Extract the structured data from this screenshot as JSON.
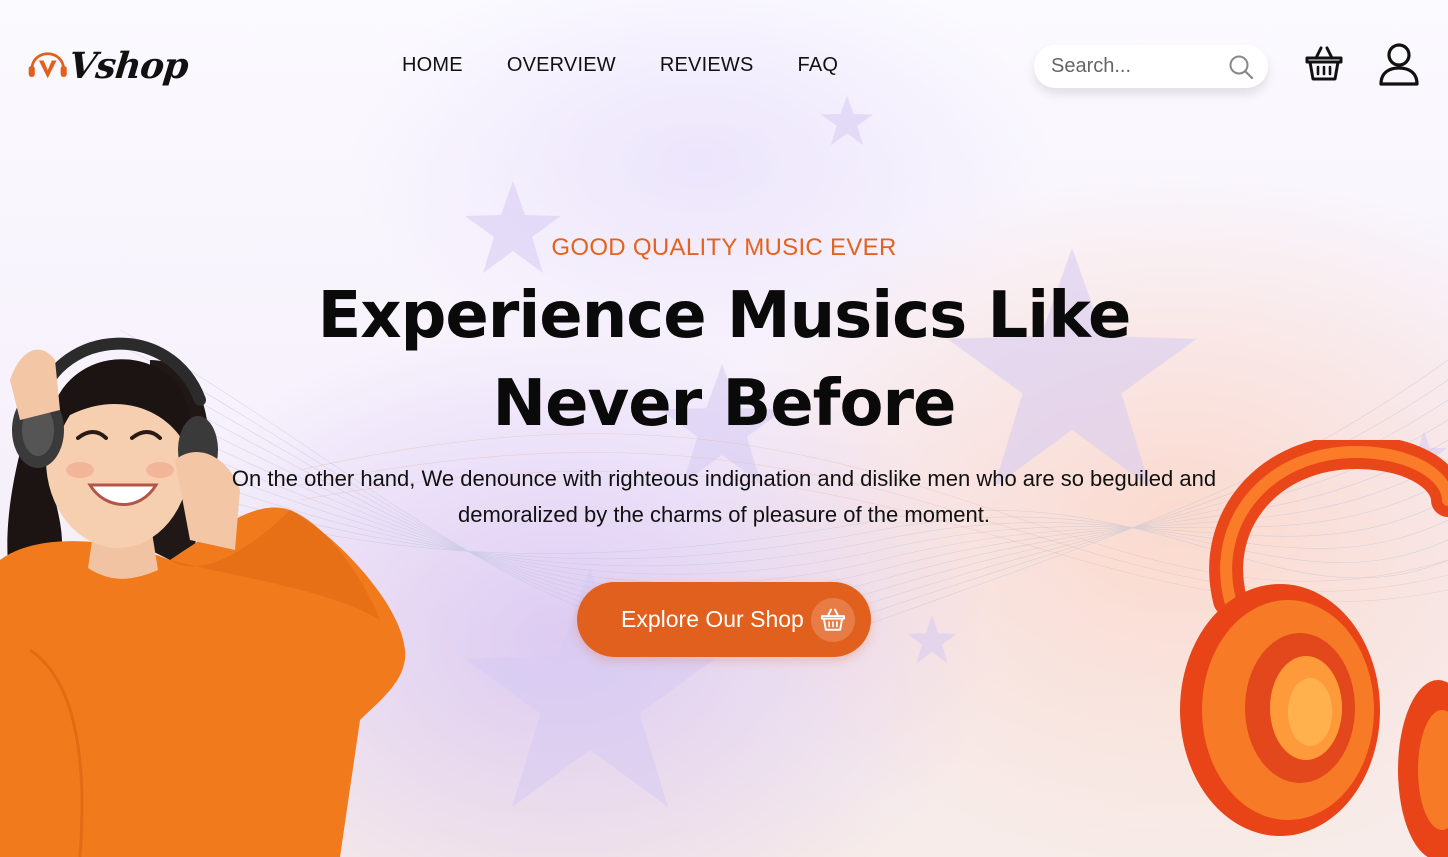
{
  "brand": {
    "name": "Vshop",
    "logo_icon": "v-headphones-logo",
    "accent": "#e2601e"
  },
  "nav": {
    "items": [
      {
        "label": "HOME"
      },
      {
        "label": "OVERVIEW"
      },
      {
        "label": "REVIEWS"
      },
      {
        "label": "FAQ"
      }
    ]
  },
  "search": {
    "placeholder": "Search...",
    "icon": "search-icon"
  },
  "header_icons": {
    "cart": "basket-icon",
    "account": "user-icon"
  },
  "hero": {
    "eyebrow": "GOOD QUALITY MUSIC EVER",
    "headline_line1": "Experience Musics Like",
    "headline_line2": "Never Before",
    "subtext": "On the other hand, We denounce with righteous indignation and dislike men who are so beguiled and demoralized by the charms of pleasure of the moment.",
    "cta_label": "Explore Our Shop",
    "cta_icon": "basket-icon"
  },
  "colors": {
    "accent": "#e2601e",
    "eyebrow": "#e5621d",
    "text": "#0a0a0a",
    "star_tint": "#d9cdf2"
  }
}
